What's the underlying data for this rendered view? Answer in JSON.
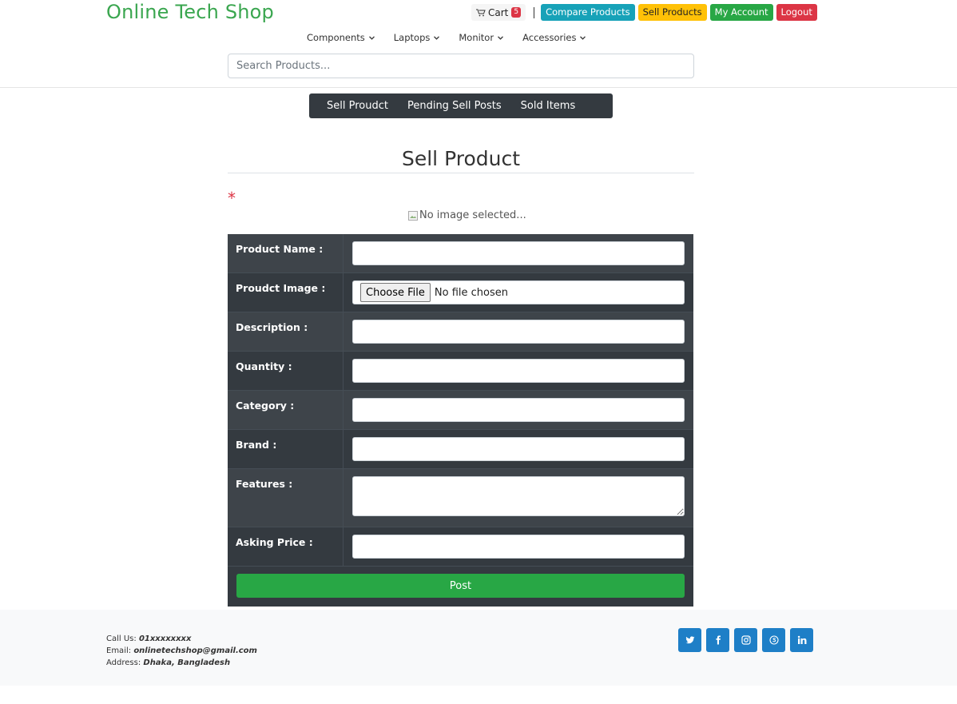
{
  "brand": "Online Tech Shop",
  "header": {
    "cart_label": "Cart",
    "cart_count": "5",
    "compare_label": "Compare Products",
    "sell_label": "Sell Products",
    "account_label": "My Account",
    "logout_label": "Logout"
  },
  "categories": [
    "Components",
    "Laptops",
    "Monitor",
    "Accessories"
  ],
  "search": {
    "placeholder": "Search Products..."
  },
  "subnav": [
    "Sell Proudct",
    "Pending Sell Posts",
    "Sold Items"
  ],
  "page_title": "Sell Product",
  "required_marker": "*",
  "image_preview_alt": "No image selected...",
  "form": {
    "fields": [
      {
        "label": "Product Name :",
        "value": ""
      },
      {
        "label": "Proudct Image :",
        "button": "Choose File",
        "status": "No file chosen"
      },
      {
        "label": "Description :",
        "value": ""
      },
      {
        "label": "Quantity :",
        "value": ""
      },
      {
        "label": "Category :",
        "value": ""
      },
      {
        "label": "Brand :",
        "value": ""
      },
      {
        "label": "Features :",
        "value": ""
      },
      {
        "label": "Asking Price :",
        "value": ""
      }
    ],
    "submit_label": "Post"
  },
  "footer": {
    "call_label": "Call Us:",
    "call_value": "01xxxxxxxx",
    "email_label": "Email:",
    "email_value": "onlinetechshop@gmail.com",
    "address_label": "Address:",
    "address_value": "Dhaka, Bangladesh",
    "socials": [
      "twitter-icon",
      "facebook-icon",
      "instagram-icon",
      "skype-icon",
      "linkedin-icon"
    ]
  },
  "colors": {
    "brand_green": "#3aa64f",
    "info": "#17a2b8",
    "warning": "#ffc107",
    "success": "#28a745",
    "danger": "#dc3545",
    "dark": "#343a40",
    "social_blue": "#1e7fc7"
  }
}
